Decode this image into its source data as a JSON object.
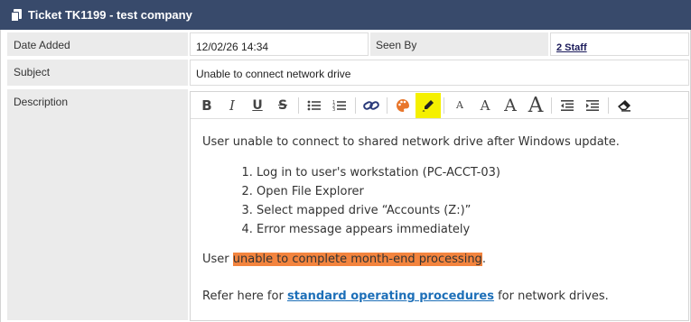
{
  "window": {
    "title": "Ticket TK1199 - test company"
  },
  "fields": {
    "date_added_label": "Date Added",
    "date_added_value": "12/02/26 14:34",
    "seen_by_label": "Seen By",
    "seen_by_value": "2 Staff",
    "subject_label": "Subject",
    "subject_value": "Unable to connect network drive",
    "description_label": "Description"
  },
  "toolbar": {
    "buttons": [
      {
        "name": "bold-icon",
        "glyph": "B"
      },
      {
        "name": "italic-icon",
        "glyph": "I"
      },
      {
        "name": "underline-icon",
        "glyph": "U"
      },
      {
        "name": "strikethrough-icon",
        "glyph": "S"
      },
      {
        "name": "bullet-list-icon"
      },
      {
        "name": "numbered-list-icon"
      },
      {
        "name": "link-icon"
      },
      {
        "name": "palette-icon"
      },
      {
        "name": "highlighter-icon"
      },
      {
        "name": "font-size-small-icon",
        "glyph": "A"
      },
      {
        "name": "font-size-medium-icon",
        "glyph": "A"
      },
      {
        "name": "font-size-large-icon",
        "glyph": "A"
      },
      {
        "name": "font-size-xlarge-icon",
        "glyph": "A"
      },
      {
        "name": "outdent-icon"
      },
      {
        "name": "indent-icon"
      },
      {
        "name": "eraser-icon"
      }
    ],
    "highlight_color": "#f5f000"
  },
  "description": {
    "intro": "User unable to connect to shared network drive after Windows update.",
    "steps": [
      "Log in to user's workstation (PC-ACCT-03)",
      "Open File Explorer",
      "Select mapped drive “Accounts (Z:)”",
      "Error message appears immediately"
    ],
    "impact_prefix": "User ",
    "impact_highlight": "unable to complete month-end processing",
    "impact_suffix": ".",
    "impact_highlight_color": "#f3843e",
    "refer_prefix": "Refer here for ",
    "refer_link": "standard operating procedures",
    "refer_suffix": " for network drives."
  },
  "colors": {
    "titlebar": "#384a6b",
    "label_bg": "#ebebeb",
    "link": "#1d6fb8"
  }
}
